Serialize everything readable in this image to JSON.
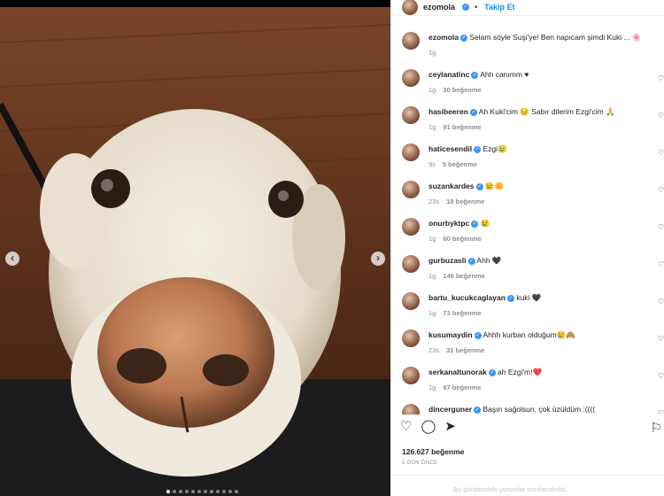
{
  "post": {
    "author": "ezomola",
    "follow_label": "Takip Et",
    "separator": "•",
    "likes": "126.627 beğenme",
    "time_ago": "1 GÜN ÖNCE",
    "footer_note": "Bu gönderideki yorumlar sınırlandırıldı."
  },
  "comments": [
    {
      "user": "ezomola",
      "text": "Selam söyle Suşi'ye! Ben napıcam şimdi Kuki ... 🌸",
      "time": "1g",
      "likes": ""
    },
    {
      "user": "ceylanatinc",
      "text": "Ahh canımm ♥",
      "time": "1g",
      "likes": "30 beğenme"
    },
    {
      "user": "hasibeeren",
      "text": "Ah Kuki'cim 😔 Sabır dilerim Ezgi'cim 🙏",
      "time": "1g",
      "likes": "91 beğenme"
    },
    {
      "user": "haticesendil",
      "text": "Ezgi😢",
      "time": "9s",
      "likes": "5 beğenme"
    },
    {
      "user": "suzankardes",
      "text": "😢🌼",
      "time": "23s",
      "likes": "18 beğenme"
    },
    {
      "user": "onurbyktpc",
      "text": "😢",
      "time": "1g",
      "likes": "60 beğenme"
    },
    {
      "user": "gurbuzasli",
      "text": "Ahh 🖤",
      "time": "1g",
      "likes": "146 beğenme"
    },
    {
      "user": "bartu_kucukcaglayan",
      "text": "kuki 🖤",
      "time": "1g",
      "likes": "73 beğenme"
    },
    {
      "user": "kusumaydin",
      "text": "Ahhh kurban olduğum😢🙈",
      "time": "23s",
      "likes": "31 beğenme"
    },
    {
      "user": "serkanaltunorak",
      "text": "ah Ezgi'm!❤️",
      "time": "1g",
      "likes": "97 beğenme"
    },
    {
      "user": "dincerguner",
      "text": "Başın sağolsun, çok üzüldüm :((((",
      "time": "1g",
      "likes": ""
    }
  ],
  "icons": {
    "prev": "‹",
    "next": "›",
    "like": "♡",
    "comment": "◯",
    "share": "➤",
    "bookmark": "⚐",
    "heart_small": "♡",
    "verified": "✓"
  },
  "carousel": {
    "total": 12,
    "active": 0
  }
}
